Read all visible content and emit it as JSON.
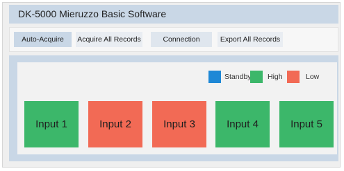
{
  "window": {
    "title": "DK-5000 Mieruzzo Basic Software"
  },
  "toolbar": {
    "buttons": [
      {
        "label": "Auto-Acquire"
      },
      {
        "label": "Acquire All Records"
      },
      {
        "label": "Connection"
      },
      {
        "label": "Export All Records"
      }
    ]
  },
  "legend": {
    "items": [
      {
        "label": "Standby",
        "color": "#1e88d6"
      },
      {
        "label": "High",
        "color": "#3cb76a"
      },
      {
        "label": "Low",
        "color": "#f26a55"
      }
    ]
  },
  "inputs": [
    {
      "label": "Input 1",
      "state": "High",
      "color": "#3cb76a"
    },
    {
      "label": "Input 2",
      "state": "Low",
      "color": "#f26a55"
    },
    {
      "label": "Input 3",
      "state": "Low",
      "color": "#f26a55"
    },
    {
      "label": "Input 4",
      "state": "High",
      "color": "#3cb76a"
    },
    {
      "label": "Input 5",
      "state": "High",
      "color": "#3cb76a"
    }
  ]
}
